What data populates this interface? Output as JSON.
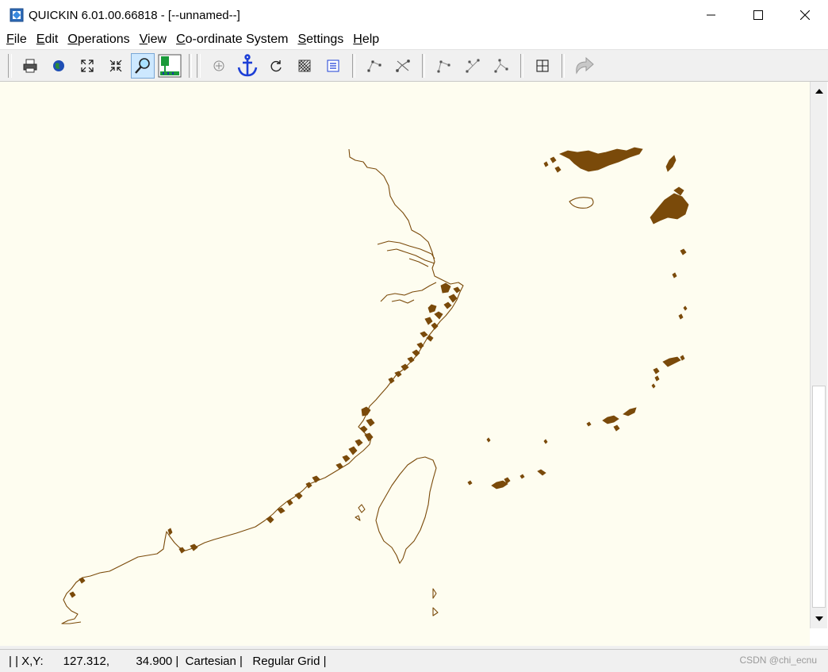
{
  "window": {
    "title": "QUICKIN 6.01.00.66818 - [--unnamed--]",
    "icons": [
      "app-icon",
      "minimize-icon",
      "maximize-icon",
      "close-icon"
    ]
  },
  "menu": {
    "items": [
      {
        "label": "File",
        "accel": "F",
        "rest": "ile"
      },
      {
        "label": "Edit",
        "accel": "E",
        "rest": "dit"
      },
      {
        "label": "Operations",
        "accel": "O",
        "rest": "perations"
      },
      {
        "label": "View",
        "accel": "V",
        "rest": "iew"
      },
      {
        "label": "Co-ordinate System",
        "accel": "C",
        "rest": "o-ordinate System"
      },
      {
        "label": "Settings",
        "accel": "S",
        "rest": "ettings"
      },
      {
        "label": "Help",
        "accel": "H",
        "rest": "elp"
      }
    ]
  },
  "toolbar": {
    "buttons": [
      "print-icon",
      "globe-icon",
      "zoom-extents-icon",
      "zoom-in-icon",
      "magnifier-icon",
      "grid-display-icon",
      "add-point-icon",
      "anchor-icon",
      "refresh-icon",
      "hatch-grid-icon",
      "list-icon",
      "polyline-icon",
      "delete-polyline-icon",
      "node-icon",
      "split-node-icon",
      "merge-node-icon",
      "crosshair-box-icon",
      "redo-icon"
    ],
    "pressed": "magnifier-icon",
    "colors": {
      "anchor": "#1d3fd6",
      "grid": "#1a9a3a",
      "grid_bg": "#2233aa"
    }
  },
  "map": {
    "background": "#fefdf0",
    "coastline_color": "#7a4a0a"
  },
  "statusbar": {
    "text": "| | X,Y:      127.312,        34.900 |  Cartesian |   Regular Grid |",
    "watermark": "CSDN @chi_ecnu"
  }
}
